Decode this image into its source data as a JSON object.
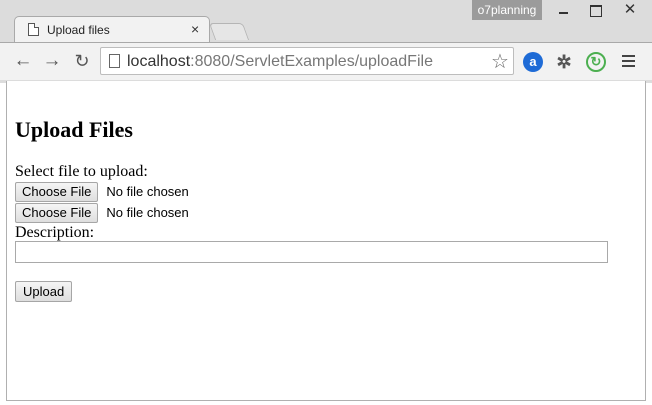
{
  "window": {
    "profile_name": "o7planning",
    "close_glyph": "✕"
  },
  "tab": {
    "title": "Upload files",
    "close_glyph": "×"
  },
  "toolbar": {
    "back_glyph": "←",
    "forward_glyph": "→",
    "reload_glyph": "↻",
    "url_host": "localhost",
    "url_path": ":8080/ServletExamples/uploadFile",
    "bookmark_glyph": "☆",
    "ext_a_label": "a",
    "ext_bug_glyph": "✲",
    "ext_c_label": "↻"
  },
  "page": {
    "heading": "Upload Files",
    "select_label": "Select file to upload:",
    "file_inputs": [
      {
        "button_label": "Choose File",
        "status": "No file chosen"
      },
      {
        "button_label": "Choose File",
        "status": "No file chosen"
      }
    ],
    "description_label": "Description:",
    "description_value": "",
    "submit_label": "Upload"
  },
  "colors": {
    "chrome_bg": "#dcdcdc",
    "tab_bg": "#f2f2f2",
    "profile_badge": "#9b9b9b",
    "ext_a": "#1e6bd6",
    "ext_c": "#4caf50"
  }
}
